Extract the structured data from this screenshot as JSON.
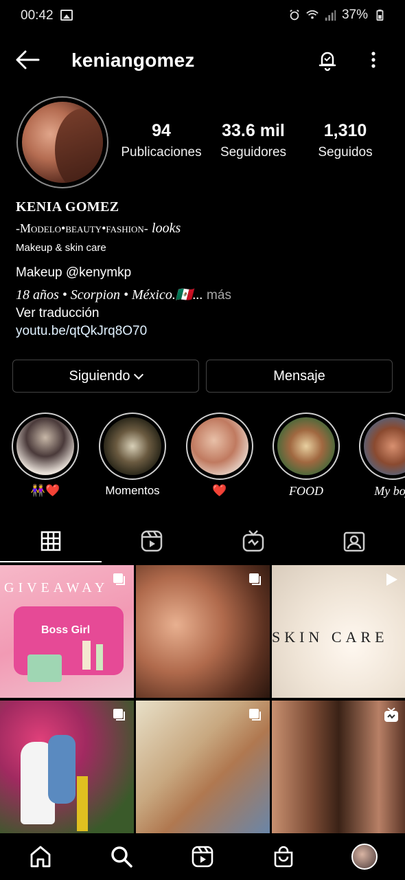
{
  "status_bar": {
    "time": "00:42",
    "battery": "37%"
  },
  "header": {
    "username": "keniangomez"
  },
  "profile": {
    "stats": [
      {
        "value": "94",
        "label": "Publicaciones"
      },
      {
        "value": "33.6 mil",
        "label": "Seguidores"
      },
      {
        "value": "1,310",
        "label": "Seguidos"
      }
    ],
    "name": "KENIA GOMEZ",
    "bio": {
      "line1": "-Modelo•beauty•fashion-",
      "line1_italic": "looks",
      "line2": "Makeup & skin care",
      "line3": "Makeup @kenymkp",
      "line4": "18 años • Scorpion • México.🇲🇽...",
      "more": "más",
      "translate": "Ver traducción",
      "link": "youtu.be/qtQkJrq8O70"
    }
  },
  "buttons": {
    "following": "Siguiendo",
    "message": "Mensaje"
  },
  "highlights": [
    {
      "label": "👭❤️"
    },
    {
      "label": "Momentos"
    },
    {
      "label": "❤️"
    },
    {
      "label": "FOOD"
    },
    {
      "label": "My boy"
    }
  ],
  "grid": {
    "post1_text": "GIVEAWAY",
    "post1_sub": "Boss Girl",
    "post3_text": "SKIN CARE"
  },
  "colors": {
    "background": "#000000",
    "link": "#e0f1ff",
    "muted": "#a8a8a8"
  }
}
